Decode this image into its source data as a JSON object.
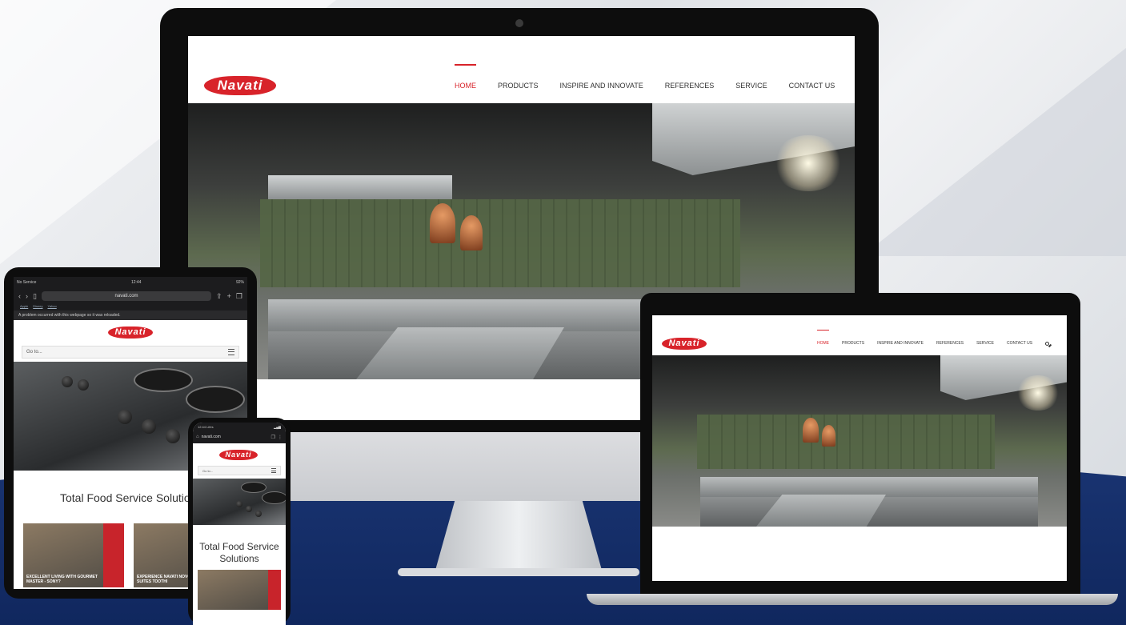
{
  "brand": {
    "logo_text": "Navati",
    "accent": "#d8232a",
    "navy": "#10275e"
  },
  "desktop_nav": {
    "items": [
      "HOME",
      "PRODUCTS",
      "INSPIRE AND INNOVATE",
      "REFERENCES",
      "SERVICE",
      "CONTACT US"
    ],
    "active": "HOME",
    "search_icon": "search-icon"
  },
  "tablet": {
    "status_left": "No Service",
    "status_time": "12:44",
    "status_right": "92%",
    "url": "navati.com",
    "favorites": [
      "Apple",
      "Disney",
      "Yahoo"
    ],
    "warning": "A problem occurred with this webpage so it was reloaded.",
    "menu_placeholder": "Go to...",
    "heading": "Total Food Service Solutio",
    "cards": [
      {
        "caption": "EXCELLENT LIVING WITH GOURMET MASTER - SONY?"
      },
      {
        "caption": "EXPERIENCE NAVATI NOVOTEL SUITES TOOTHI"
      }
    ]
  },
  "phone": {
    "status_time": "12:44 Lifes",
    "url": "navati.com",
    "menu_placeholder": "Go to...",
    "heading_line1": "Total Food Service",
    "heading_line2": "Solutions"
  }
}
